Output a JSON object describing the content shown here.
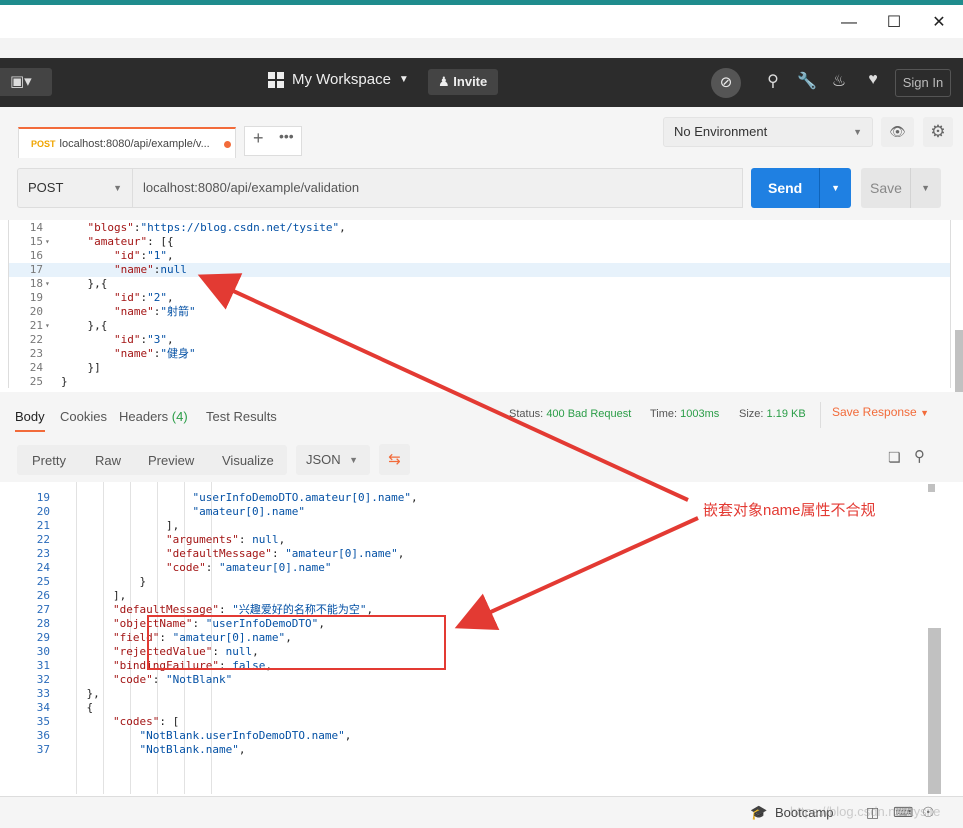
{
  "window": {
    "min": "—",
    "max": "☐",
    "close": "✕"
  },
  "header": {
    "new_icon": "▣▾",
    "workspace": "My Workspace",
    "workspace_caret": "▼",
    "invite": "Invite",
    "signin": "Sign In",
    "icons": [
      "sync-off-icon",
      "satellite-icon",
      "wrench-icon",
      "bell-icon",
      "heart-icon"
    ]
  },
  "tab": {
    "method": "POST",
    "title": "localhost:8080/api/example/v..."
  },
  "environment": {
    "label": "No Environment"
  },
  "request": {
    "method": "POST",
    "url": "localhost:8080/api/example/validation",
    "send": "Send",
    "save": "Save"
  },
  "request_body": [
    {
      "n": "14",
      "fold": "",
      "tokens": [
        [
          "p",
          "    "
        ],
        [
          "k",
          "\"blogs\""
        ],
        [
          "p",
          ":"
        ],
        [
          "s",
          "\"https://blog.csdn.net/tysite\""
        ],
        [
          "p",
          ","
        ]
      ]
    },
    {
      "n": "15",
      "fold": "▾",
      "tokens": [
        [
          "p",
          "    "
        ],
        [
          "k",
          "\"amateur\""
        ],
        [
          "p",
          ": [{"
        ]
      ]
    },
    {
      "n": "16",
      "fold": "",
      "tokens": [
        [
          "p",
          "        "
        ],
        [
          "k",
          "\"id\""
        ],
        [
          "p",
          ":"
        ],
        [
          "s",
          "\"1\""
        ],
        [
          "p",
          ","
        ]
      ]
    },
    {
      "n": "17",
      "fold": "",
      "hl": true,
      "tokens": [
        [
          "p",
          "        "
        ],
        [
          "k",
          "\"name\""
        ],
        [
          "p",
          ":"
        ],
        [
          "lit",
          "null"
        ]
      ]
    },
    {
      "n": "18",
      "fold": "▾",
      "tokens": [
        [
          "p",
          "    },{"
        ]
      ]
    },
    {
      "n": "19",
      "fold": "",
      "tokens": [
        [
          "p",
          "        "
        ],
        [
          "k",
          "\"id\""
        ],
        [
          "p",
          ":"
        ],
        [
          "s",
          "\"2\""
        ],
        [
          "p",
          ","
        ]
      ]
    },
    {
      "n": "20",
      "fold": "",
      "tokens": [
        [
          "p",
          "        "
        ],
        [
          "k",
          "\"name\""
        ],
        [
          "p",
          ":"
        ],
        [
          "s",
          "\"射箭\""
        ]
      ]
    },
    {
      "n": "21",
      "fold": "▾",
      "tokens": [
        [
          "p",
          "    },{"
        ]
      ]
    },
    {
      "n": "22",
      "fold": "",
      "tokens": [
        [
          "p",
          "        "
        ],
        [
          "k",
          "\"id\""
        ],
        [
          "p",
          ":"
        ],
        [
          "s",
          "\"3\""
        ],
        [
          "p",
          ","
        ]
      ]
    },
    {
      "n": "23",
      "fold": "",
      "tokens": [
        [
          "p",
          "        "
        ],
        [
          "k",
          "\"name\""
        ],
        [
          "p",
          ":"
        ],
        [
          "s",
          "\"健身\""
        ]
      ]
    },
    {
      "n": "24",
      "fold": "",
      "tokens": [
        [
          "p",
          "    }]"
        ]
      ]
    },
    {
      "n": "25",
      "fold": "",
      "tokens": [
        [
          "p",
          "}"
        ]
      ]
    }
  ],
  "response_tabs": {
    "body": "Body",
    "cookies": "Cookies",
    "headers": "Headers",
    "headers_count": "(4)",
    "tests": "Test Results",
    "status_label": "Status:",
    "status": "400 Bad Request",
    "time_label": "Time:",
    "time": "1003ms",
    "size_label": "Size:",
    "size": "1.19 KB",
    "save_response": "Save Response"
  },
  "response_toolbar": {
    "pretty": "Pretty",
    "raw": "Raw",
    "preview": "Preview",
    "visualize": "Visualize",
    "format": "JSON"
  },
  "response_body": [
    {
      "n": "19",
      "tokens": [
        [
          "p",
          "                    "
        ],
        [
          "s",
          "\"userInfoDemoDTO.amateur[0].name\""
        ],
        [
          "p",
          ","
        ]
      ]
    },
    {
      "n": "20",
      "tokens": [
        [
          "p",
          "                    "
        ],
        [
          "s",
          "\"amateur[0].name\""
        ]
      ]
    },
    {
      "n": "21",
      "tokens": [
        [
          "p",
          "                ],"
        ]
      ]
    },
    {
      "n": "22",
      "tokens": [
        [
          "p",
          "                "
        ],
        [
          "k",
          "\"arguments\""
        ],
        [
          "p",
          ": "
        ],
        [
          "lit",
          "null"
        ],
        [
          "p",
          ","
        ]
      ]
    },
    {
      "n": "23",
      "tokens": [
        [
          "p",
          "                "
        ],
        [
          "k",
          "\"defaultMessage\""
        ],
        [
          "p",
          ": "
        ],
        [
          "s",
          "\"amateur[0].name\""
        ],
        [
          "p",
          ","
        ]
      ]
    },
    {
      "n": "24",
      "tokens": [
        [
          "p",
          "                "
        ],
        [
          "k",
          "\"code\""
        ],
        [
          "p",
          ": "
        ],
        [
          "s",
          "\"amateur[0].name\""
        ]
      ]
    },
    {
      "n": "25",
      "tokens": [
        [
          "p",
          "            }"
        ]
      ]
    },
    {
      "n": "26",
      "tokens": [
        [
          "p",
          "        ],"
        ]
      ]
    },
    {
      "n": "27",
      "tokens": [
        [
          "p",
          "        "
        ],
        [
          "k",
          "\"defaultMessage\""
        ],
        [
          "p",
          ": "
        ],
        [
          "s",
          "\"兴趣爱好的名称不能为空\""
        ],
        [
          "p",
          ","
        ]
      ]
    },
    {
      "n": "28",
      "tokens": [
        [
          "p",
          "        "
        ],
        [
          "k",
          "\"objectName\""
        ],
        [
          "p",
          ": "
        ],
        [
          "s",
          "\"userInfoDemoDTO\""
        ],
        [
          "p",
          ","
        ]
      ]
    },
    {
      "n": "29",
      "tokens": [
        [
          "p",
          "        "
        ],
        [
          "k",
          "\"field\""
        ],
        [
          "p",
          ": "
        ],
        [
          "s",
          "\"amateur[0].name\""
        ],
        [
          "p",
          ","
        ]
      ]
    },
    {
      "n": "30",
      "tokens": [
        [
          "p",
          "        "
        ],
        [
          "k",
          "\"rejectedValue\""
        ],
        [
          "p",
          ": "
        ],
        [
          "lit",
          "null"
        ],
        [
          "p",
          ","
        ]
      ]
    },
    {
      "n": "31",
      "tokens": [
        [
          "p",
          "        "
        ],
        [
          "k",
          "\"bindingFailure\""
        ],
        [
          "p",
          ": "
        ],
        [
          "lit",
          "false"
        ],
        [
          "p",
          ","
        ]
      ]
    },
    {
      "n": "32",
      "tokens": [
        [
          "p",
          "        "
        ],
        [
          "k",
          "\"code\""
        ],
        [
          "p",
          ": "
        ],
        [
          "s",
          "\"NotBlank\""
        ]
      ]
    },
    {
      "n": "33",
      "tokens": [
        [
          "p",
          "    },"
        ]
      ]
    },
    {
      "n": "34",
      "tokens": [
        [
          "p",
          "    {"
        ]
      ]
    },
    {
      "n": "35",
      "tokens": [
        [
          "p",
          "        "
        ],
        [
          "k",
          "\"codes\""
        ],
        [
          "p",
          ": ["
        ]
      ]
    },
    {
      "n": "36",
      "tokens": [
        [
          "p",
          "            "
        ],
        [
          "s",
          "\"NotBlank.userInfoDemoDTO.name\""
        ],
        [
          "p",
          ","
        ]
      ]
    },
    {
      "n": "37",
      "tokens": [
        [
          "p",
          "            "
        ],
        [
          "s",
          "\"NotBlank.name\""
        ],
        [
          "p",
          ","
        ]
      ]
    }
  ],
  "annotation": "嵌套对象name属性不合规",
  "annotation_color": "#e33a33",
  "footer": {
    "bootcamp": "Bootcamp",
    "watermark": "https://blog.csdn.net/tysite"
  },
  "colors": {
    "accent": "#f26b3a",
    "send": "#1f80e2",
    "header": "#2c2c2c",
    "status_ok": "#2a9d47"
  }
}
